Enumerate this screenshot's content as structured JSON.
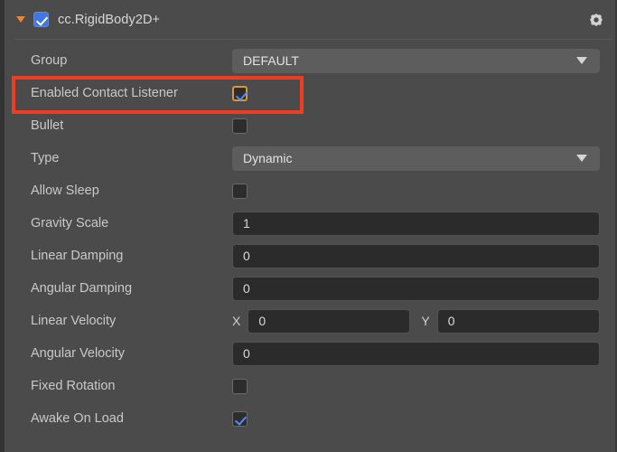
{
  "component": {
    "title": "cc.RigidBody2D+",
    "enabled": true,
    "expanded": true,
    "fold_icon": "triangle-down-icon",
    "settings_icon": "gear-icon"
  },
  "theme": {
    "panel_bg": "#4b4b4b",
    "label_color": "#c9c9c9",
    "dropdown_bg": "#5d5d5d",
    "input_bg": "#2b2b2b",
    "accent_check": "#5c87f5",
    "accent_fold": "#e8883a",
    "highlight_border": "#f03c20",
    "focus_border": "#d79a2b"
  },
  "annotation": {
    "type": "highlight-rectangle",
    "target": "Enabled Contact Listener",
    "color": "#f03c20"
  },
  "properties": [
    {
      "label": "Group",
      "control": "dropdown",
      "value": "DEFAULT",
      "icon": "chevron-down-icon"
    },
    {
      "label": "Enabled Contact Listener",
      "control": "checkbox",
      "checked": true,
      "focused": true,
      "highlighted": true
    },
    {
      "label": "Bullet",
      "control": "checkbox",
      "checked": false
    },
    {
      "label": "Type",
      "control": "dropdown",
      "value": "Dynamic",
      "icon": "chevron-down-icon"
    },
    {
      "label": "Allow Sleep",
      "control": "checkbox",
      "checked": false
    },
    {
      "label": "Gravity Scale",
      "control": "number",
      "value": "1"
    },
    {
      "label": "Linear Damping",
      "control": "number",
      "value": "0"
    },
    {
      "label": "Angular Damping",
      "control": "number",
      "value": "0"
    },
    {
      "label": "Linear Velocity",
      "control": "vector2",
      "x_label": "X",
      "x_value": "0",
      "y_label": "Y",
      "y_value": "0"
    },
    {
      "label": "Angular Velocity",
      "control": "number",
      "value": "0"
    },
    {
      "label": "Fixed Rotation",
      "control": "checkbox",
      "checked": false
    },
    {
      "label": "Awake On Load",
      "control": "checkbox",
      "checked": true
    }
  ]
}
